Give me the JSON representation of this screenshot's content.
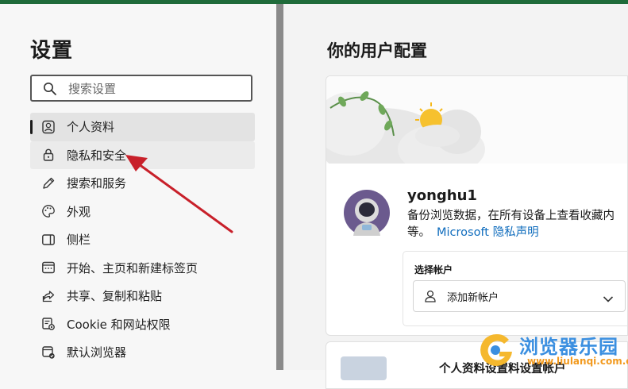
{
  "sidebar": {
    "title": "设置",
    "search": {
      "placeholder": "搜索设置",
      "value": ""
    },
    "items": [
      {
        "label": "个人资料",
        "icon": "profile-icon"
      },
      {
        "label": "隐私和安全",
        "icon": "lock-icon"
      },
      {
        "label": "搜索和服务",
        "icon": "pen-icon"
      },
      {
        "label": "外观",
        "icon": "palette-icon"
      },
      {
        "label": "侧栏",
        "icon": "sidebar-icon"
      },
      {
        "label": "开始、主页和新建标签页",
        "icon": "home-tab-icon"
      },
      {
        "label": "共享、复制和粘贴",
        "icon": "share-icon"
      },
      {
        "label": "Cookie 和网站权限",
        "icon": "site-permissions-icon"
      },
      {
        "label": "默认浏览器",
        "icon": "default-browser-icon"
      }
    ]
  },
  "main": {
    "title": "你的用户配置",
    "profile": {
      "username": "yonghu1",
      "description_line1": "备份浏览数据，在所有设备上查看收藏内",
      "description_line2": "等。",
      "privacy_link": "Microsoft 隐私声明",
      "account_section_label": "选择帐户",
      "account_select_value": "添加新帐户"
    },
    "second_card_title": "个人资料设置料设置帐户"
  },
  "watermark": {
    "brand": "浏览器乐园",
    "url": "www.liulanqi.com.cn"
  },
  "colors": {
    "top_accent": "#1f6b3a",
    "link": "#0f6cbd",
    "arrow": "#c8202a",
    "watermark_blue": "#3b8fe0",
    "watermark_orange": "#f29a1f"
  }
}
